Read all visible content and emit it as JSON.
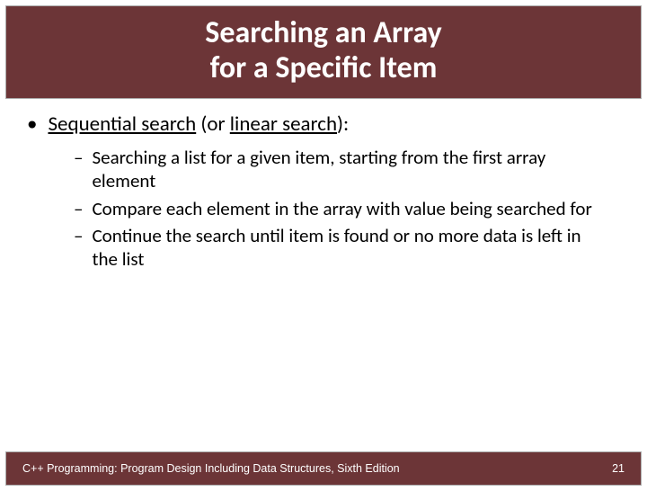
{
  "title": {
    "line1": "Searching an Array",
    "line2": "for a Specific Item"
  },
  "bullet": {
    "prefix": "Sequential search",
    "middle": " (or ",
    "u2": "linear search",
    "suffix": "):"
  },
  "subs": {
    "s1": "Searching a list for a given item, starting from the first array element",
    "s2": "Compare each element in the array with value being searched for",
    "s3": "Continue the search until item is found or no more data is left in the list"
  },
  "footer": {
    "left": "C++ Programming: Program Design Including Data Structures, Sixth Edition",
    "page": "21"
  }
}
